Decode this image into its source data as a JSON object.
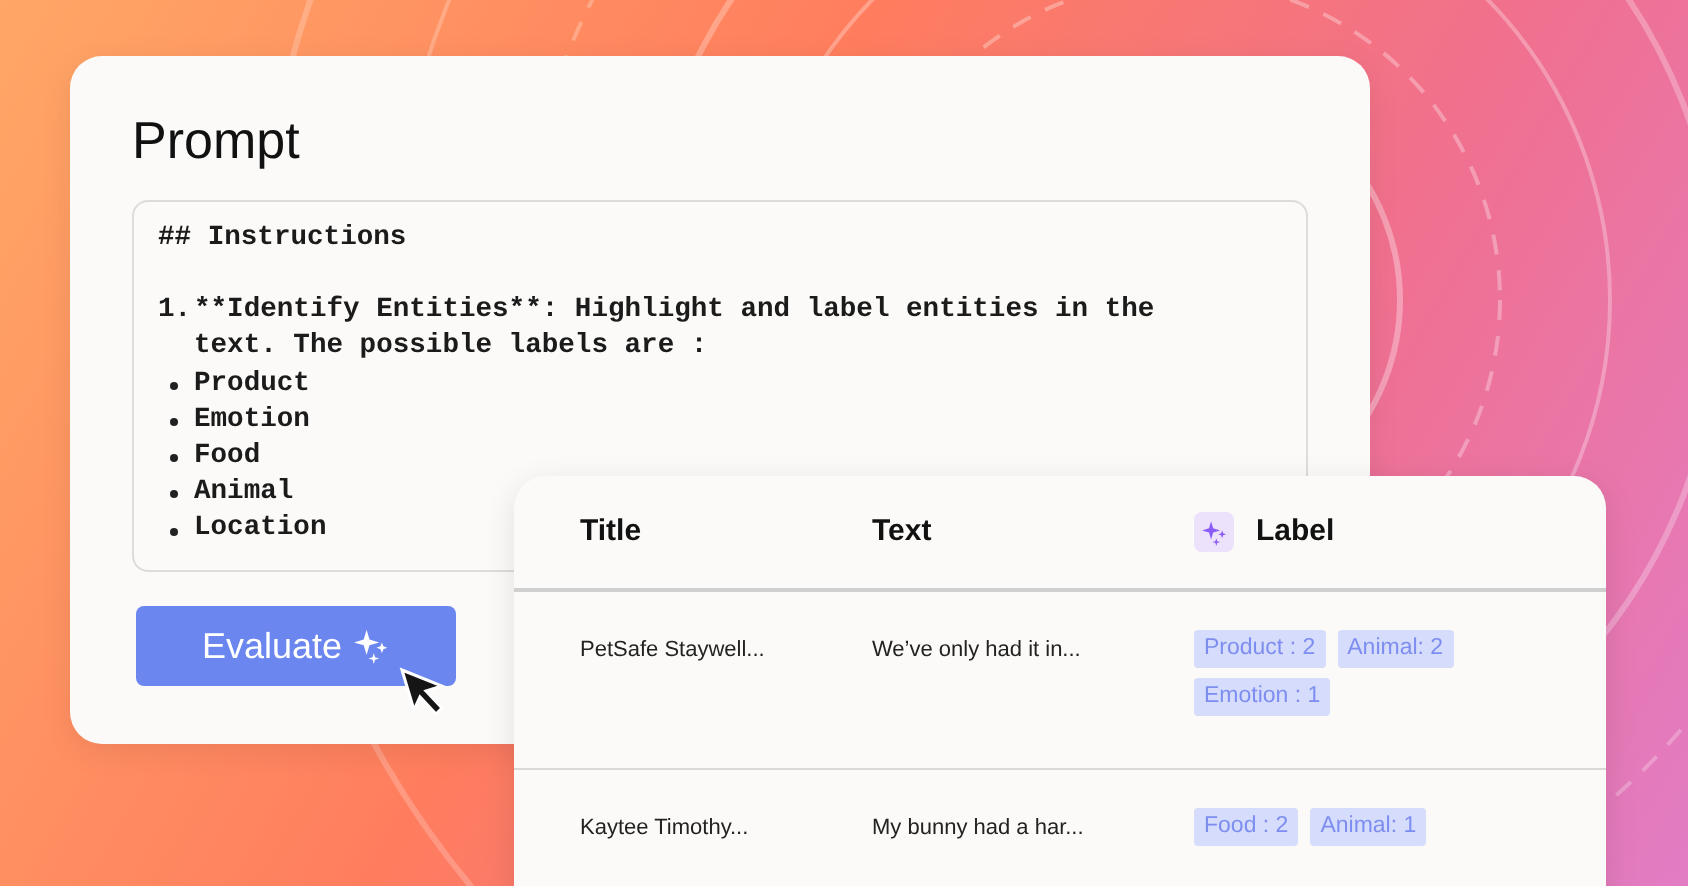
{
  "prompt": {
    "title": "Prompt",
    "heading": "## Instructions",
    "steps": [
      {
        "number": "1.",
        "text": "**Identify Entities**: Highlight and label entities in the text. The possible labels are :",
        "bullets": [
          "Product",
          "Emotion",
          "Food",
          "Animal",
          "Location"
        ]
      }
    ],
    "button": "Evaluate"
  },
  "table": {
    "columns": [
      {
        "label": "Title",
        "kind": "plain"
      },
      {
        "label": "Text",
        "kind": "plain"
      },
      {
        "label": "Label",
        "kind": "ai"
      }
    ],
    "rows": [
      {
        "title": "PetSafe Staywell...",
        "text": "We’ve only had it in...",
        "labels": [
          "Product : 2",
          "Animal: 2",
          "Emotion : 1"
        ]
      },
      {
        "title": "Kaytee Timothy...",
        "text": "My bunny had a har...",
        "labels": [
          "Food : 2",
          "Animal: 1"
        ]
      }
    ]
  }
}
